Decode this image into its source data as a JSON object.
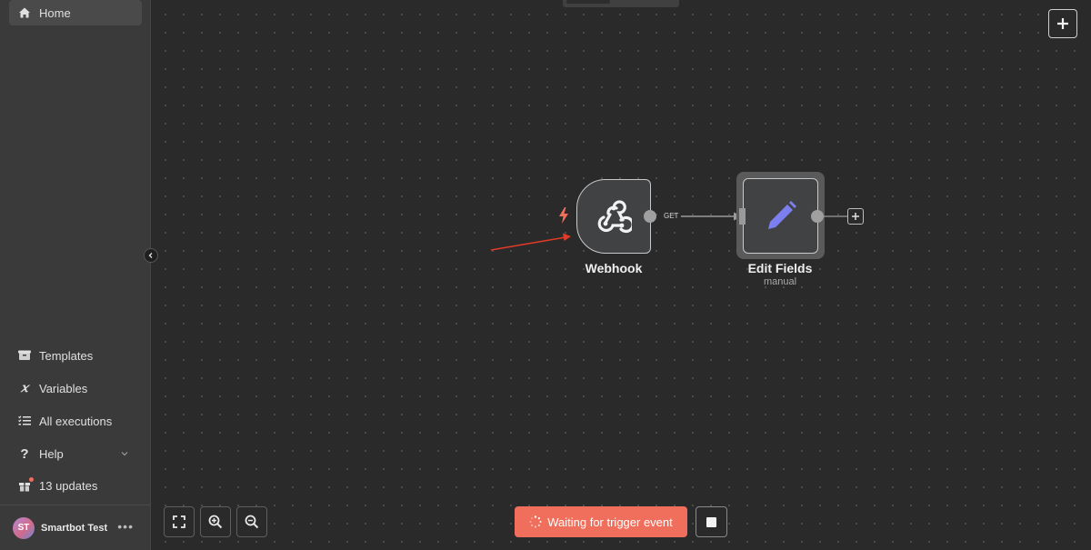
{
  "sidebar": {
    "home_label": "Home",
    "items": [
      {
        "label": "Templates",
        "icon": "box-icon"
      },
      {
        "label": "Variables",
        "icon": "variable-icon"
      },
      {
        "label": "All executions",
        "icon": "list-check-icon"
      },
      {
        "label": "Help",
        "icon": "question-icon"
      },
      {
        "label": "13 updates",
        "icon": "gift-icon"
      }
    ],
    "user": {
      "initials": "ST",
      "name": "Smartbot Test"
    }
  },
  "canvas": {
    "nodes": [
      {
        "label": "Webhook",
        "icon": "webhook-icon"
      },
      {
        "label": "Edit Fields",
        "subtitle": "manual",
        "icon": "pencil-icon"
      }
    ],
    "connection_label": "GET"
  },
  "controls": {
    "waiting_label": "Waiting for trigger event"
  },
  "colors": {
    "accent": "#f06e5c",
    "pencil": "#7b7ff0",
    "trigger_bolt": "#f06e5c"
  }
}
